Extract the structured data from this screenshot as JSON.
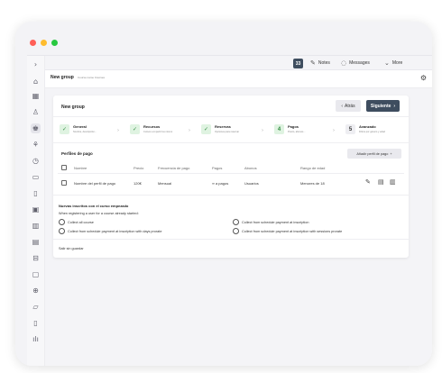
{
  "colors": {
    "dot_red": "#ff5f57",
    "dot_yellow": "#febc2e",
    "dot_green": "#28c840",
    "primary": "#3e4d5f",
    "success": "#2e8b3e"
  },
  "sidebar": {
    "toggle_icon": "chevron-right-icon",
    "items": [
      "home-icon",
      "calendar-icon",
      "users-icon",
      "group-icon",
      "school-icon",
      "clock-icon",
      "folder-icon",
      "document-icon",
      "wallet-icon",
      "chart-icon",
      "report-icon",
      "car-icon",
      "book-icon",
      "lock-icon",
      "file-icon",
      "clipboard-icon",
      "analytics-icon"
    ]
  },
  "topbar": {
    "badge": "33",
    "notes": "Notes",
    "messages": "Messages",
    "more": "More"
  },
  "breadcrumb": {
    "title": "New group",
    "sub": "Course name  Courses"
  },
  "card": {
    "title": "New group",
    "back_label": "Atrás",
    "next_label": "Siguiente",
    "steps": [
      {
        "title": "General",
        "desc": "Nombre, descripción...",
        "badge": "✓"
      },
      {
        "title": "Recursos",
        "desc": "Cursos a impartir los mismo",
        "badge": "✓"
      },
      {
        "title": "Reservas",
        "desc": "Opciones para reservar",
        "badge": "✓"
      },
      {
        "title": "Pagos",
        "desc": "Precio, abonos...",
        "badge": "4"
      },
      {
        "title": "Avanzado",
        "desc": "Filtros por género y edad",
        "badge": "5"
      }
    ]
  },
  "payment_profiles": {
    "title": "Perfiles de pago",
    "add_label": "Añadir perfil de pago",
    "columns": [
      "Nombre",
      "Precio",
      "Frecuencia de pago",
      "Pagos",
      "Abonos",
      "Rango de edad"
    ],
    "rows": [
      {
        "nombre": "Nombre del perfil de pago",
        "precio": "120€",
        "frecuencia": "Mensual",
        "pagos": "∞ a pagos",
        "abonos": "Usuarios",
        "rango": "Menores de 18"
      }
    ]
  },
  "inscriptions": {
    "title": "Nuevas inscritos con el curso empezado",
    "prompt": "When registering a user for a course already started:",
    "options": [
      "Collect all course",
      "Collect from schedule payment at inscription",
      "Collect from schedule payment at inscription with days prorate",
      "Collect from schedule payment at inscription with sessions prorate"
    ]
  },
  "exit_label": "Salir sin guardar"
}
